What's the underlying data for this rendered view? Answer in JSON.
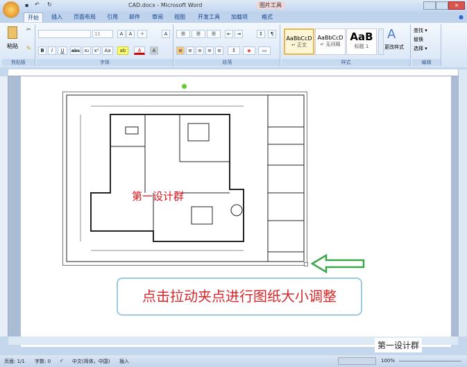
{
  "title_bar": {
    "doc_name": "CAD.docx - Microsoft Word",
    "context_tab": "图片工具"
  },
  "tabs": [
    "开始",
    "插入",
    "页面布局",
    "引用",
    "邮件",
    "审阅",
    "视图",
    "开发工具",
    "加载项",
    "格式"
  ],
  "ribbon": {
    "clipboard": {
      "paste": "粘贴",
      "label": "剪贴板"
    },
    "font": {
      "size": "11",
      "label": "字体",
      "buttons": [
        "B",
        "I",
        "U",
        "abc",
        "x₂",
        "x²",
        "Aa",
        "A",
        "A"
      ]
    },
    "paragraph": {
      "label": "段落"
    },
    "styles": {
      "label": "样式",
      "items": [
        {
          "preview": "AaBbCcD",
          "name": "↵ 正文"
        },
        {
          "preview": "AaBbCcD",
          "name": "↵ 无间隔"
        },
        {
          "preview": "AaB",
          "name": "标题 1"
        }
      ],
      "change": "更改样式"
    },
    "editing": {
      "label": "编辑",
      "items": [
        "查找 ▾",
        "替换",
        "选择 ▾"
      ]
    }
  },
  "document": {
    "watermark": "第一设计群",
    "callout": "点击拉动夹点进行图纸大小调整"
  },
  "overlay_watermark": "第一设计群",
  "status": {
    "page": "页面: 1/1",
    "words": "字数: 0",
    "language": "中文(简体，中国)",
    "mode": "插入",
    "zoom": "100%"
  }
}
